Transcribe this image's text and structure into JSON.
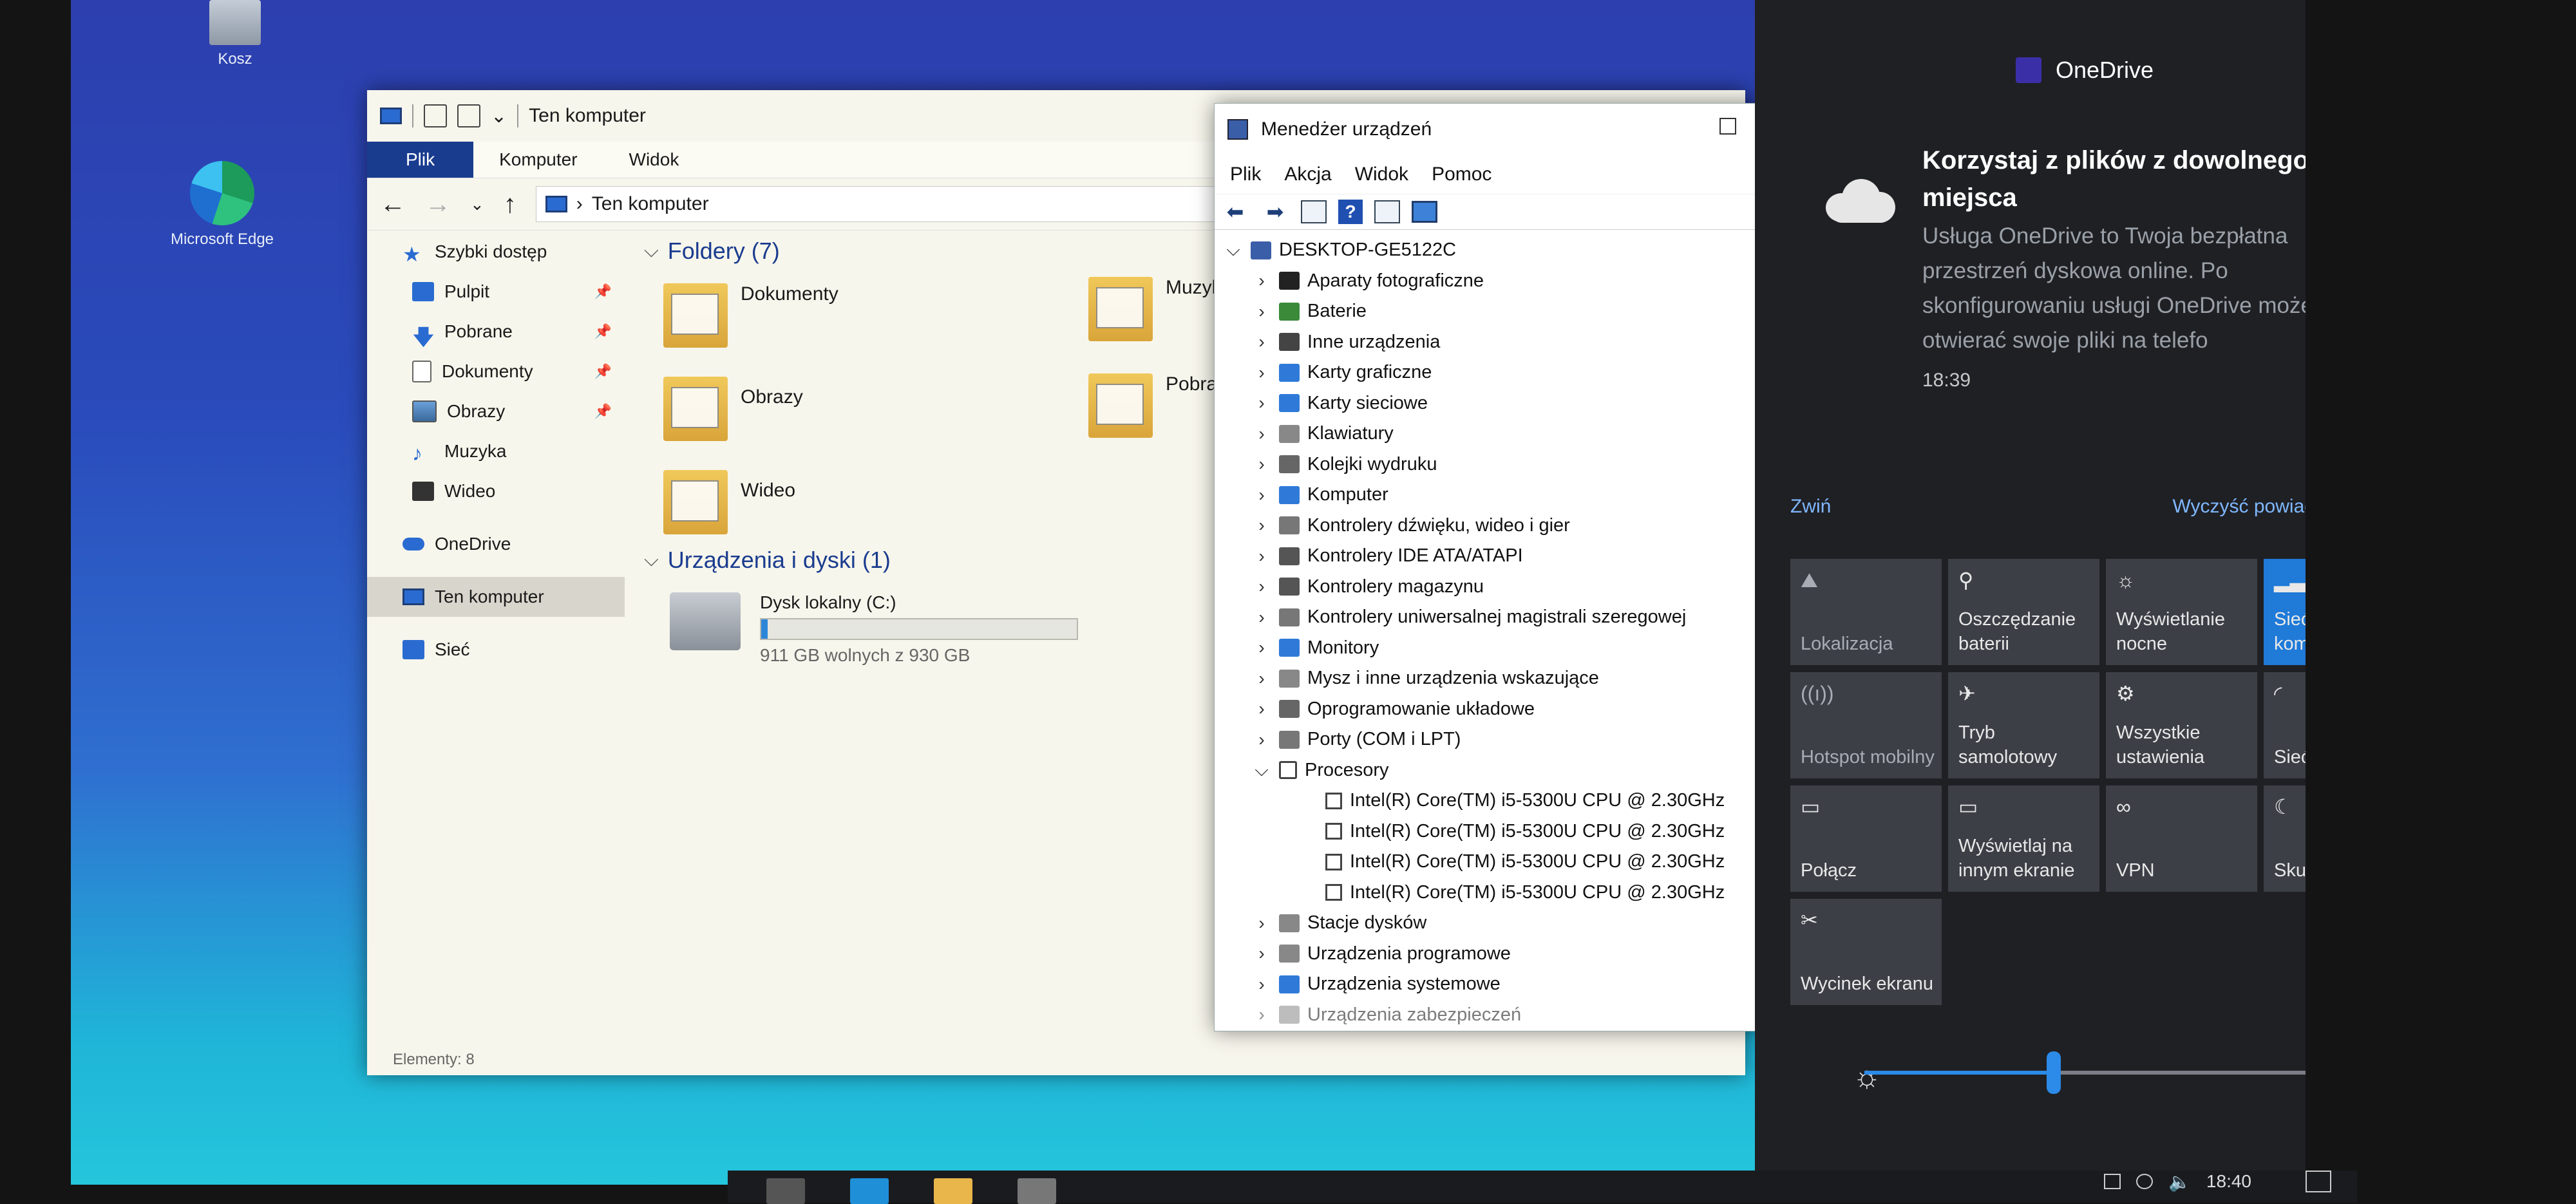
{
  "desktop": {
    "icons": [
      {
        "label": "Kosz"
      },
      {
        "label": "Microsoft Edge"
      }
    ]
  },
  "explorer": {
    "title": "Ten komputer",
    "ribbon_tabs": [
      "Plik",
      "Komputer",
      "Widok"
    ],
    "address": "Ten komputer",
    "sidebar": {
      "quick_access": "Szybki dostęp",
      "items": [
        {
          "label": "Pulpit",
          "pinned": true
        },
        {
          "label": "Pobrane",
          "pinned": true
        },
        {
          "label": "Dokumenty",
          "pinned": true
        },
        {
          "label": "Obrazy",
          "pinned": true
        },
        {
          "label": "Muzyka",
          "pinned": false
        },
        {
          "label": "Wideo",
          "pinned": false
        }
      ],
      "onedrive": "OneDrive",
      "this_pc": "Ten komputer",
      "network": "Sieć"
    },
    "folders_header": "Foldery (7)",
    "folders": [
      "Dokumenty",
      "Obrazy",
      "Wideo",
      "Muzyka",
      "Pobrane"
    ],
    "devices_header": "Urządzenia i dyski (1)",
    "drive": {
      "name": "Dysk lokalny (C:)",
      "free_text": "911 GB wolnych z 930 GB",
      "used_fraction": 0.02
    },
    "status": "Elementy: 8"
  },
  "device_manager": {
    "title": "Menedżer urządzeń",
    "menu": [
      "Plik",
      "Akcja",
      "Widok",
      "Pomoc"
    ],
    "root": "DESKTOP-GE5122C",
    "categories": [
      {
        "label": "Aparaty fotograficzne",
        "color": "#222222"
      },
      {
        "label": "Baterie",
        "color": "#3a8a3a"
      },
      {
        "label": "Inne urządzenia",
        "color": "#444444"
      },
      {
        "label": "Karty graficzne",
        "color": "#2f7ad8"
      },
      {
        "label": "Karty sieciowe",
        "color": "#2f7ad8"
      },
      {
        "label": "Klawiatury",
        "color": "#888888"
      },
      {
        "label": "Kolejki wydruku",
        "color": "#666666"
      },
      {
        "label": "Komputer",
        "color": "#2f7ad8"
      },
      {
        "label": "Kontrolery dźwięku, wideo i gier",
        "color": "#777777"
      },
      {
        "label": "Kontrolery IDE ATA/ATAPI",
        "color": "#555555"
      },
      {
        "label": "Kontrolery magazynu",
        "color": "#555555"
      },
      {
        "label": "Kontrolery uniwersalnej magistrali szeregowej",
        "color": "#777777"
      },
      {
        "label": "Monitory",
        "color": "#2f7ad8"
      },
      {
        "label": "Mysz i inne urządzenia wskazujące",
        "color": "#888888"
      },
      {
        "label": "Oprogramowanie układowe",
        "color": "#666666"
      },
      {
        "label": "Porty (COM i LPT)",
        "color": "#777777"
      }
    ],
    "processors_label": "Procesory",
    "processors": [
      "Intel(R) Core(TM) i5-5300U CPU @ 2.30GHz",
      "Intel(R) Core(TM) i5-5300U CPU @ 2.30GHz",
      "Intel(R) Core(TM) i5-5300U CPU @ 2.30GHz",
      "Intel(R) Core(TM) i5-5300U CPU @ 2.30GHz"
    ],
    "after": [
      {
        "label": "Stacje dysków",
        "color": "#888888"
      },
      {
        "label": "Urządzenia programowe",
        "color": "#888888"
      },
      {
        "label": "Urządzenia systemowe",
        "color": "#2f7ad8"
      },
      {
        "label": "Urządzenia zabezpieczeń",
        "color": "#888888"
      }
    ]
  },
  "action_center": {
    "app": "OneDrive",
    "notification": {
      "title": "Korzystaj z plików z dowolnego miejsca",
      "body": "Usługa OneDrive to Twoja bezpłatna przestrzeń dyskowa online. Po skonfigurowaniu usługi OneDrive możesz otwierać swoje pliki na telefo",
      "time": "18:39"
    },
    "collapse": "Zwiń",
    "clear_all": "Wyczyść powiadomienia",
    "tiles": [
      {
        "label": "Lokalizacja",
        "icon": "⛰",
        "on": false,
        "dim": true
      },
      {
        "label": "Oszczędzanie baterii",
        "icon": "⚲",
        "on": false,
        "dim": false
      },
      {
        "label": "Wyświetlanie nocne",
        "icon": "☼",
        "on": false,
        "dim": false
      },
      {
        "label": "Sieć komórkowa",
        "icon": "▂▃▅",
        "on": true,
        "dim": false
      },
      {
        "label": "Hotspot mobilny",
        "icon": "((ı))",
        "on": false,
        "dim": true
      },
      {
        "label": "Tryb samolotowy",
        "icon": "✈",
        "on": false,
        "dim": false
      },
      {
        "label": "Wszystkie ustawienia",
        "icon": "⚙",
        "on": false,
        "dim": false
      },
      {
        "label": "Sieć",
        "icon": "◜",
        "on": false,
        "dim": false
      },
      {
        "label": "Połącz",
        "icon": "▭",
        "on": false,
        "dim": false
      },
      {
        "label": "Wyświetlaj na innym ekranie",
        "icon": "▭",
        "on": false,
        "dim": false
      },
      {
        "label": "VPN",
        "icon": "∞",
        "on": false,
        "dim": false
      },
      {
        "label": "Skupienie",
        "icon": "☾",
        "on": false,
        "dim": false
      },
      {
        "label": "Wycinek ekranu",
        "icon": "✂",
        "on": false,
        "dim": false
      }
    ],
    "brightness": 0.4
  },
  "taskbar": {
    "time": "18:40"
  }
}
